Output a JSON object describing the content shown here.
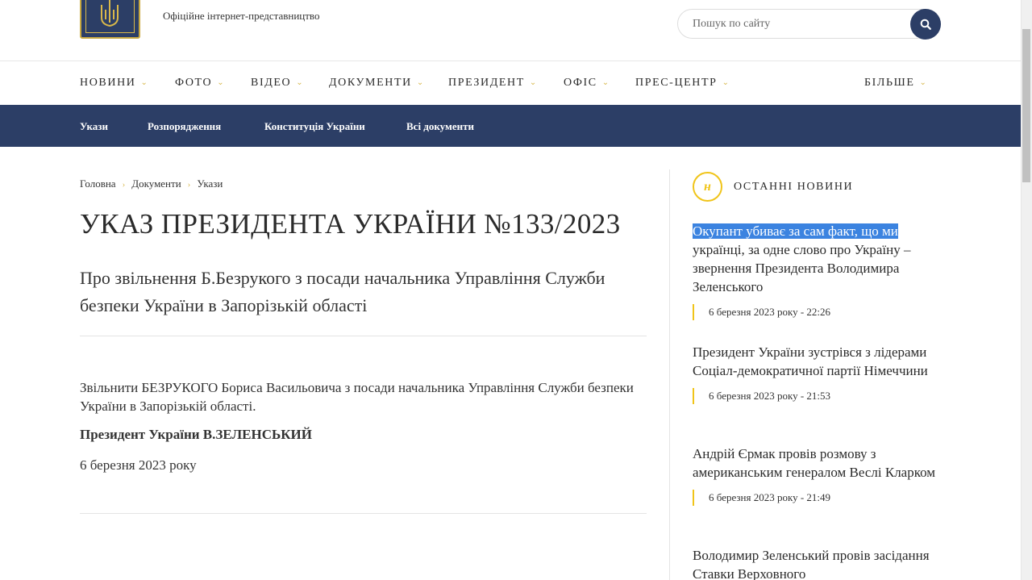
{
  "header": {
    "tagline": "Офіційне інтернет-представництво",
    "search_placeholder": "Пошук по сайту"
  },
  "main_nav": [
    {
      "label": "НОВИНИ"
    },
    {
      "label": "ФОТО"
    },
    {
      "label": "ВІДЕО"
    },
    {
      "label": "ДОКУМЕНТИ"
    },
    {
      "label": "ПРЕЗИДЕНТ"
    },
    {
      "label": "ОФІС"
    },
    {
      "label": "ПРЕС-ЦЕНТР"
    },
    {
      "label": "БІЛЬШЕ"
    }
  ],
  "sub_nav": [
    "Укази",
    "Розпорядження",
    "Конституція України",
    "Всі документи"
  ],
  "breadcrumb": [
    "Головна",
    "Документи",
    "Укази"
  ],
  "document": {
    "title": "УКАЗ ПРЕЗИДЕНТА УКРАЇНИ №133/2023",
    "subtitle": "Про звільнення Б.Безрукого з посади начальника Управління Служби безпеки України в Запорізькій області",
    "body": "Звільнити БЕЗРУКОГО Бориса Васильовича з посади начальника Управління Служби безпеки України в Запорізькій області.",
    "signature": "Президент України В.ЗЕЛЕНСЬКИЙ",
    "date": "6 березня 2023 року"
  },
  "sidebar": {
    "badge_letter": "н",
    "heading": "ОСТАННІ НОВИНИ",
    "news": [
      {
        "title_highlighted": "Окупант убиває за сам факт, що ми",
        "title": " українці, за одне слово про Україну – звернення Президента Володимира Зеленського",
        "time": "6 березня 2023 року - 22:26"
      },
      {
        "title_highlighted": "",
        "title": "Президент України зустрівся з лідерами Соціал-демократичної партії Німеччини",
        "time": "6 березня 2023 року - 21:53"
      },
      {
        "title_highlighted": "",
        "title": "Андрій Єрмак провів розмову з американським генералом Веслі Кларком",
        "time": "6 березня 2023 року - 21:49"
      },
      {
        "title_highlighted": "",
        "title": "Володимир Зеленський провів засідання Ставки Верховного",
        "time": ""
      }
    ]
  },
  "colors": {
    "navy": "#2c3e66",
    "gold": "#f0c419",
    "highlight": "#3b83e0"
  },
  "icons": {
    "logo": "trident-emblem-icon",
    "search": "search-icon",
    "chevron": "chevron-down-icon"
  }
}
